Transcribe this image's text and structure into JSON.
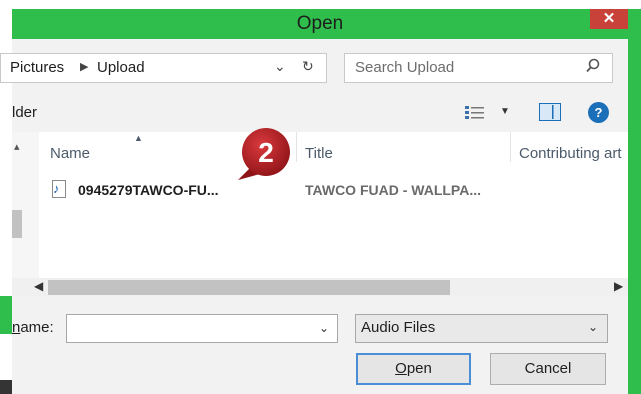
{
  "window": {
    "title": "Open",
    "close_glyph": "✕"
  },
  "address_bar": {
    "crumbs": [
      "Pictures",
      "Upload"
    ],
    "separator_icon": "chevron-right-icon",
    "dropdown_icon": "chevron-down-icon",
    "refresh_icon": "refresh-icon"
  },
  "search": {
    "placeholder": "Search Upload",
    "icon": "search-icon"
  },
  "toolbar": {
    "new_folder_label": "lder",
    "view_icon": "view-details-icon",
    "pane_icon": "preview-pane-icon",
    "help_label": "?"
  },
  "file_list": {
    "columns": [
      "Name",
      "Title",
      "Contributing art"
    ],
    "rows": [
      {
        "icon": "audio-file-icon",
        "name": "0945279TAWCO-FU...",
        "title": "TAWCO FUAD - WALLPA..."
      }
    ]
  },
  "callout": {
    "number": "2",
    "color": "#b41e23"
  },
  "bottom": {
    "name_label_prefix": "n",
    "name_label_rest": "ame:",
    "name_value": "",
    "file_type": "Audio Files",
    "open_label_prefix": "O",
    "open_label_rest": "pen",
    "cancel_label": "Cancel"
  },
  "colors": {
    "titlebar": "#2fbd4c",
    "close_button": "#c8423a",
    "primary_focus": "#4a8fd6"
  }
}
